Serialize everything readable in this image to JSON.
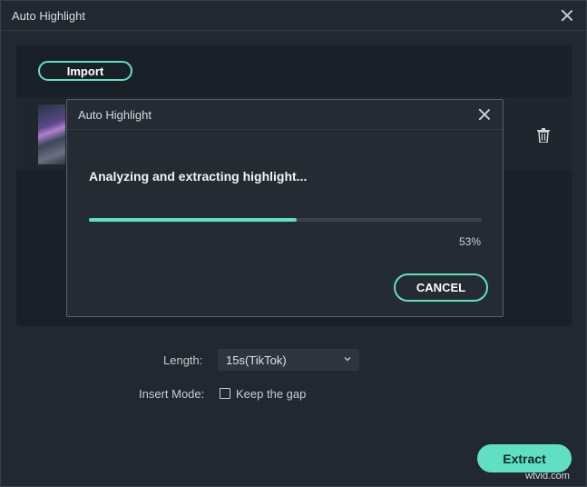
{
  "window": {
    "title": "Auto Highlight",
    "close_icon": "close-icon"
  },
  "panel": {
    "import_label": "Import",
    "trash_icon": "trash-icon"
  },
  "settings": {
    "length_label": "Length:",
    "length_value": "15s(TikTok)",
    "insert_mode_label": "Insert Mode:",
    "keep_gap_label": "Keep the gap",
    "keep_gap_checked": false
  },
  "extract_label": "Extract",
  "watermark": "wtvid.com",
  "modal": {
    "title": "Auto Highlight",
    "message": "Analyzing and extracting highlight...",
    "progress_percent": 53,
    "progress_text": "53%",
    "cancel_label": "CANCEL"
  },
  "colors": {
    "accent": "#5fe0c2",
    "background": "#222830",
    "panel": "#1a2027"
  }
}
